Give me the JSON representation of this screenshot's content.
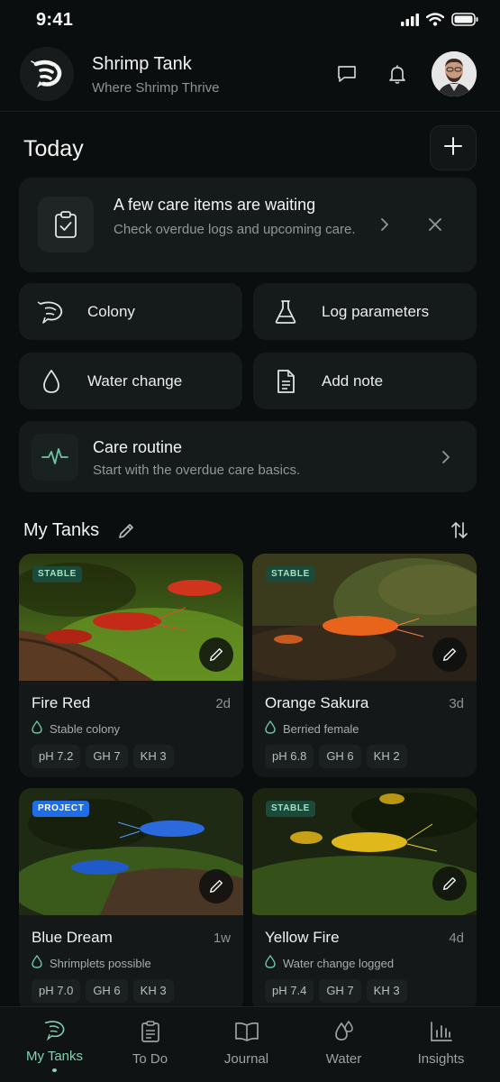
{
  "status_bar": {
    "time": "9:41"
  },
  "header": {
    "title": "Shrimp Tank",
    "subtitle": "Where Shrimp Thrive",
    "logo_icon": "shrimp-logo-icon",
    "icons": [
      "chat-icon",
      "bell-icon"
    ],
    "avatar": "user-avatar"
  },
  "today": {
    "title": "Today",
    "add_icon": "plus-icon",
    "alert": {
      "title": "A few care items are waiting",
      "text": "Check overdue logs and upcoming care.",
      "icon": "clipboard-check-icon"
    },
    "actions": [
      {
        "label": "Colony",
        "icon": "shrimp-icon"
      },
      {
        "label": "Log parameters",
        "icon": "flask-icon"
      },
      {
        "label": "Water change",
        "icon": "droplet-icon"
      },
      {
        "label": "Add note",
        "icon": "document-icon"
      }
    ],
    "routine": {
      "title": "Care routine",
      "text": "Start with the overdue care basics.",
      "icon": "pulse-icon"
    }
  },
  "tanks": {
    "title": "My Tanks",
    "items": [
      {
        "name": "Fire Red",
        "age": "2d",
        "badge": "STABLE",
        "status": "Stable colony",
        "params": [
          "pH 7.2",
          "GH 7",
          "KH 3"
        ]
      },
      {
        "name": "Orange Sakura",
        "age": "3d",
        "badge": "STABLE",
        "status": "Berried female",
        "params": [
          "pH 6.8",
          "GH 6",
          "KH 2"
        ]
      },
      {
        "name": "Blue Dream",
        "age": "1w",
        "badge": "PROJECT",
        "status": "Shrimplets possible",
        "params": [
          "pH 7.0",
          "GH 6",
          "KH 3"
        ]
      },
      {
        "name": "Yellow Fire",
        "age": "4d",
        "badge": "STABLE",
        "status": "Water change logged",
        "params": [
          "pH 7.4",
          "GH 7",
          "KH 3"
        ]
      }
    ]
  },
  "nav": {
    "items": [
      {
        "label": "My Tanks",
        "icon": "shrimp-icon",
        "active": true
      },
      {
        "label": "To Do",
        "icon": "clipboard-icon"
      },
      {
        "label": "Journal",
        "icon": "book-icon"
      },
      {
        "label": "Water",
        "icon": "droplets-icon"
      },
      {
        "label": "Insights",
        "icon": "bar-chart-icon"
      }
    ]
  },
  "colors": {
    "background": "#0b0e0e",
    "card": "#151a1a",
    "accent": "#7fd3b3",
    "badge_stable": "#1c4a3a",
    "badge_project": "#1f6ee8"
  }
}
